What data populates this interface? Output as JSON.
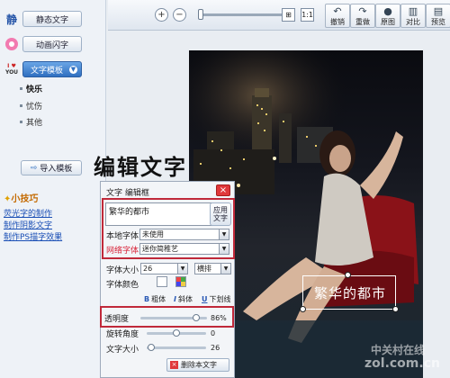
{
  "sidebar": {
    "static_text": {
      "icon_char": "静",
      "label": "静态文字"
    },
    "animated_text": {
      "label": "动画闪字"
    },
    "text_template": {
      "icon_lines": [
        "I ♥",
        "YOU"
      ],
      "label": "文字模板"
    },
    "template_items": [
      "快乐",
      "忧伤",
      "其他"
    ],
    "import_template": {
      "label": "导入模板"
    },
    "tips": {
      "title": "小技巧",
      "links": [
        "荧光字的制作",
        "制作阴影文字",
        "制作PS描字效果"
      ]
    }
  },
  "toolbar": {
    "zoom_in_icon": "+",
    "zoom_out_icon": "−",
    "fit_icon": "⊞",
    "actual_size_label": "1:1",
    "buttons": [
      {
        "id": "undo",
        "label": "撤销",
        "icon": "↶"
      },
      {
        "id": "redo",
        "label": "重做",
        "icon": "↷"
      },
      {
        "id": "original",
        "label": "原图",
        "icon": "●"
      },
      {
        "id": "compare",
        "label": "对比",
        "icon": "▥"
      },
      {
        "id": "preview",
        "label": "预览",
        "icon": "▤"
      }
    ]
  },
  "heading": "编辑文字",
  "editor": {
    "title": "文字 编辑框",
    "close_icon": "×",
    "text_value": "繁华的都市",
    "apply_label": "应用文字",
    "local_font_label": "本地字体",
    "local_font_value": "未使用",
    "web_font_label": "网络字体",
    "web_font_value": "迷你简稚艺",
    "font_size_label": "字体大小",
    "font_size_value": "26",
    "orientation_value": "横排",
    "font_color_label": "字体颜色",
    "bold_label": "粗体",
    "italic_label": "斜体",
    "underline_label": "下划线",
    "bold_icon": "B",
    "italic_icon": "I",
    "underline_icon": "U",
    "opacity_label": "透明度",
    "opacity_value": "86%",
    "opacity_fraction": 0.86,
    "rotation_label": "旋转角度",
    "rotation_value": "0",
    "text_size_label": "文字大小",
    "text_size_value": "26",
    "delete_label": "删除本文字"
  },
  "canvas": {
    "caption": "繁华的都市"
  },
  "watermark": {
    "line1": "中关村在线",
    "line2": "zol.com.cn"
  },
  "colors": {
    "accent": "#2f6fc0",
    "highlight": "#c0293a",
    "web_font_label": "#d9253a"
  }
}
